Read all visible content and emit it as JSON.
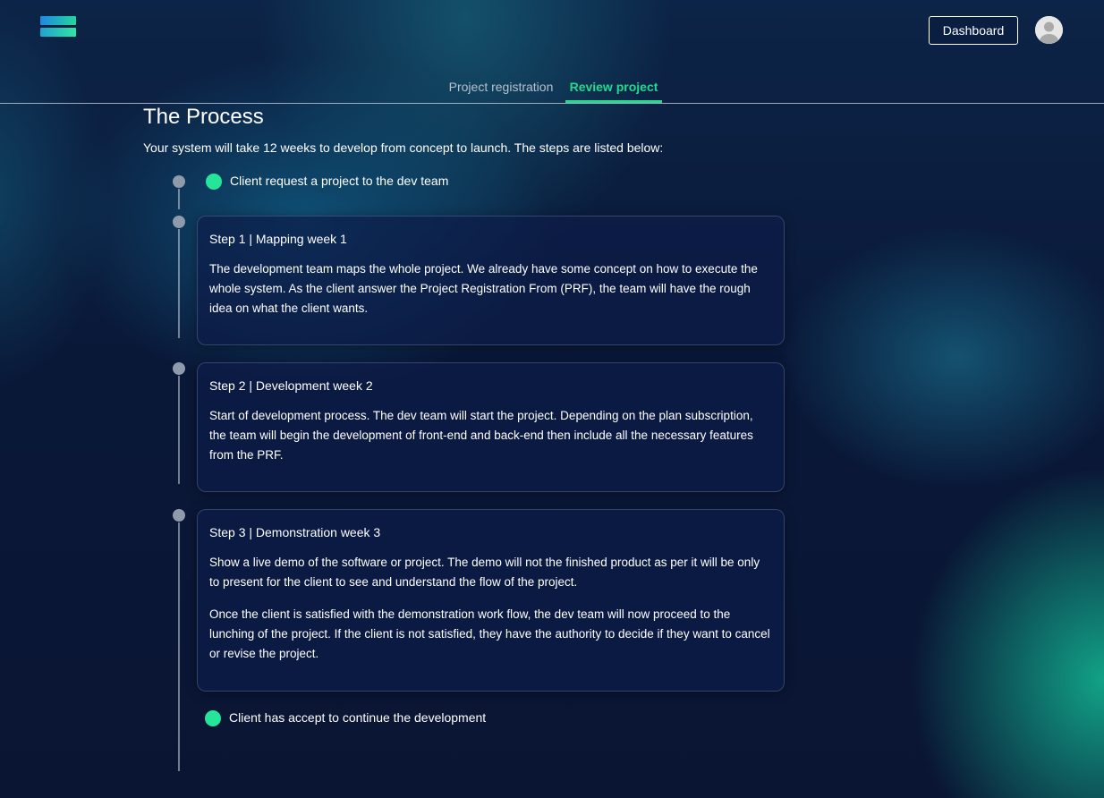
{
  "header": {
    "logo_icon": "stacked-bars-logo",
    "dashboard_label": "Dashboard",
    "avatar_icon": "user-avatar-icon"
  },
  "tabs": [
    {
      "label": "Project registration",
      "active": false
    },
    {
      "label": "Review project",
      "active": true
    }
  ],
  "colors": {
    "accent": "#25d98f",
    "background": "#0b1638",
    "card": "#0c1c48"
  },
  "process": {
    "title": "The Process",
    "intro": "Your system will take 12 weeks to develop from concept to launch. The steps are listed below:",
    "start_status": "Client request a project to the dev team",
    "steps": [
      {
        "title": "Step 1 | Mapping week 1",
        "paragraphs": [
          "The development team maps the whole project. We already have some concept on how to execute the whole system. As the client answer the Project Registration From (PRF), the team will have the rough idea on what the client wants."
        ]
      },
      {
        "title": "Step 2 | Development week 2",
        "paragraphs": [
          "Start of development process. The dev team will start the project. Depending on the plan subscription, the team will begin the development of front-end and back-end then include all the necessary features from the PRF."
        ]
      },
      {
        "title": "Step 3 | Demonstration week 3",
        "paragraphs": [
          "Show a live demo of the software or project. The demo will not the finished product as per it will be only to present for the client to see and understand the flow of the project.",
          "Once the client is satisfied with the demonstration work flow, the dev team will now proceed to the lunching of the project. If the client is not satisfied, they have the authority to decide if they want to cancel or revise the project."
        ]
      }
    ],
    "end_status": "Client has accept to continue the development"
  }
}
